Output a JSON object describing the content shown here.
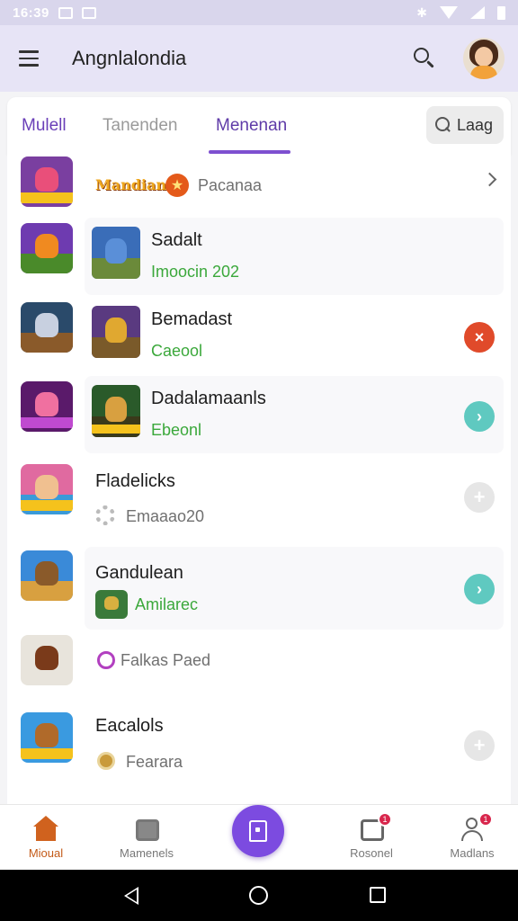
{
  "status_bar": {
    "time": "16:39"
  },
  "app_bar": {
    "title": "Angnlalondia",
    "menu_icon": "hamburger-menu-icon",
    "search_icon": "search-icon",
    "avatar_icon": "user-avatar-icon"
  },
  "tabs": [
    {
      "label": "Mulell",
      "selected": false
    },
    {
      "label": "Tanenden",
      "selected": false
    },
    {
      "label": "Menenan",
      "selected": true
    }
  ],
  "language_button": {
    "label": "Laag"
  },
  "list": [
    {
      "title": "",
      "banner": "Mandian",
      "sub": "Pacanaa",
      "sub_style": "gray",
      "action": "chevron",
      "thumb": null
    },
    {
      "title": "Sadalt",
      "sub": "Imoocin 202",
      "sub_style": "green",
      "action": "none",
      "thumb": "blue-creature"
    },
    {
      "title": "Bemadast",
      "sub": "Caeool",
      "sub_style": "green",
      "action": "red",
      "thumb": "gold-warrior"
    },
    {
      "title": "Dadalamaanls",
      "sub": "Ebeonl",
      "sub_style": "green",
      "action": "teal",
      "thumb": "green-warrior"
    },
    {
      "title": "Fladelicks",
      "sub": "Emaaao20",
      "sub_style": "gray",
      "action": "gray",
      "thumb": null
    },
    {
      "title": "Gandulean",
      "sub": "Amilarec",
      "sub_style": "green",
      "action": "teal",
      "thumb": "small-scene"
    },
    {
      "title": "",
      "sub": "Falkas Paed",
      "sub_style": "gray",
      "action": "none",
      "thumb": null
    },
    {
      "title": "Eacalols",
      "sub": "Fearara",
      "sub_style": "gray",
      "action": "gray",
      "thumb": null
    }
  ],
  "bottom_nav": [
    {
      "label": "Mioual",
      "icon": "home-icon",
      "active": true,
      "badge": ""
    },
    {
      "label": "Mamenels",
      "icon": "box-icon",
      "active": false,
      "badge": ""
    },
    {
      "label": "",
      "icon": "center-action-icon",
      "active": false,
      "badge": ""
    },
    {
      "label": "Rosonel",
      "icon": "box-icon",
      "active": false,
      "badge": "1"
    },
    {
      "label": "Madlans",
      "icon": "user-icon",
      "active": false,
      "badge": "1"
    }
  ],
  "colors": {
    "accent": "#7e50d0",
    "status_red": "#e04a2a",
    "status_teal": "#5fc9c0",
    "positive_green": "#3ba83b",
    "nav_active": "#d0621e"
  }
}
